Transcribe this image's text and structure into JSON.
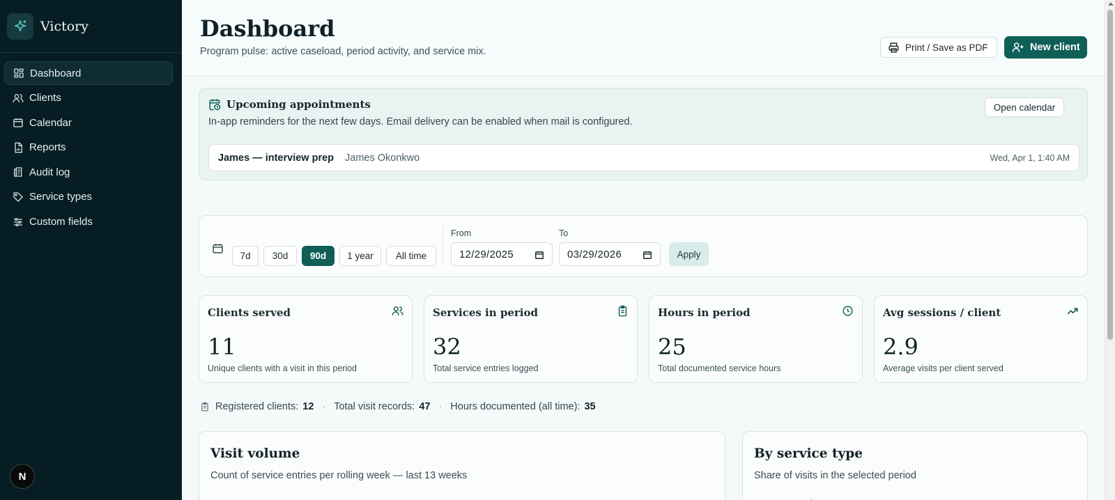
{
  "app": {
    "name": "Victory"
  },
  "sidebar": {
    "items": [
      {
        "label": "Dashboard",
        "icon": "dashboard-icon",
        "active": true
      },
      {
        "label": "Clients",
        "icon": "users-icon"
      },
      {
        "label": "Calendar",
        "icon": "calendar-icon"
      },
      {
        "label": "Reports",
        "icon": "report-icon"
      },
      {
        "label": "Audit log",
        "icon": "audit-log-icon"
      },
      {
        "label": "Service types",
        "icon": "tag-icon"
      },
      {
        "label": "Custom fields",
        "icon": "sliders-icon"
      }
    ],
    "avatar_initial": "N"
  },
  "header": {
    "title": "Dashboard",
    "subtitle": "Program pulse: active caseload, period activity, and service mix.",
    "print_label": "Print / Save as PDF",
    "new_client_label": "New client"
  },
  "appointments": {
    "title": "Upcoming appointments",
    "description": "In-app reminders for the next few days. Email delivery can be enabled when mail is configured.",
    "open_calendar_label": "Open calendar",
    "items": [
      {
        "name": "James — interview prep",
        "client": "James Okonkwo",
        "time": "Wed, Apr 1, 1:40 AM"
      }
    ]
  },
  "filter": {
    "ranges": [
      {
        "label": "7d"
      },
      {
        "label": "30d"
      },
      {
        "label": "90d",
        "active": true
      },
      {
        "label": "1 year"
      },
      {
        "label": "All time"
      }
    ],
    "from_label": "From",
    "from_value": "12/29/2025",
    "to_label": "To",
    "to_value": "03/29/2026",
    "apply_label": "Apply"
  },
  "kpis": [
    {
      "title": "Clients served",
      "value": "11",
      "note": "Unique clients with a visit in this period",
      "icon": "users-icon"
    },
    {
      "title": "Services in period",
      "value": "32",
      "note": "Total service entries logged",
      "icon": "clipboard-icon"
    },
    {
      "title": "Hours in period",
      "value": "25",
      "note": "Total documented service hours",
      "icon": "clock-icon"
    },
    {
      "title": "Avg sessions / client",
      "value": "2.9",
      "note": "Average visits per client served",
      "icon": "trending-up-icon"
    }
  ],
  "totals": {
    "registered_label": "Registered clients:",
    "registered_value": "12",
    "visits_label": "Total visit records:",
    "visits_value": "47",
    "hours_label": "Hours documented (all time):",
    "hours_value": "35"
  },
  "panels": {
    "visit_volume": {
      "title": "Visit volume",
      "subtitle": "Count of service entries per rolling week — last 13 weeks"
    },
    "by_service_type": {
      "title": "By service type",
      "subtitle": "Share of visits in the selected period"
    }
  },
  "colors": {
    "sidebar_bg": "#071d24",
    "accent": "#0f5e58",
    "chart_bar": "#1f9a5f"
  }
}
